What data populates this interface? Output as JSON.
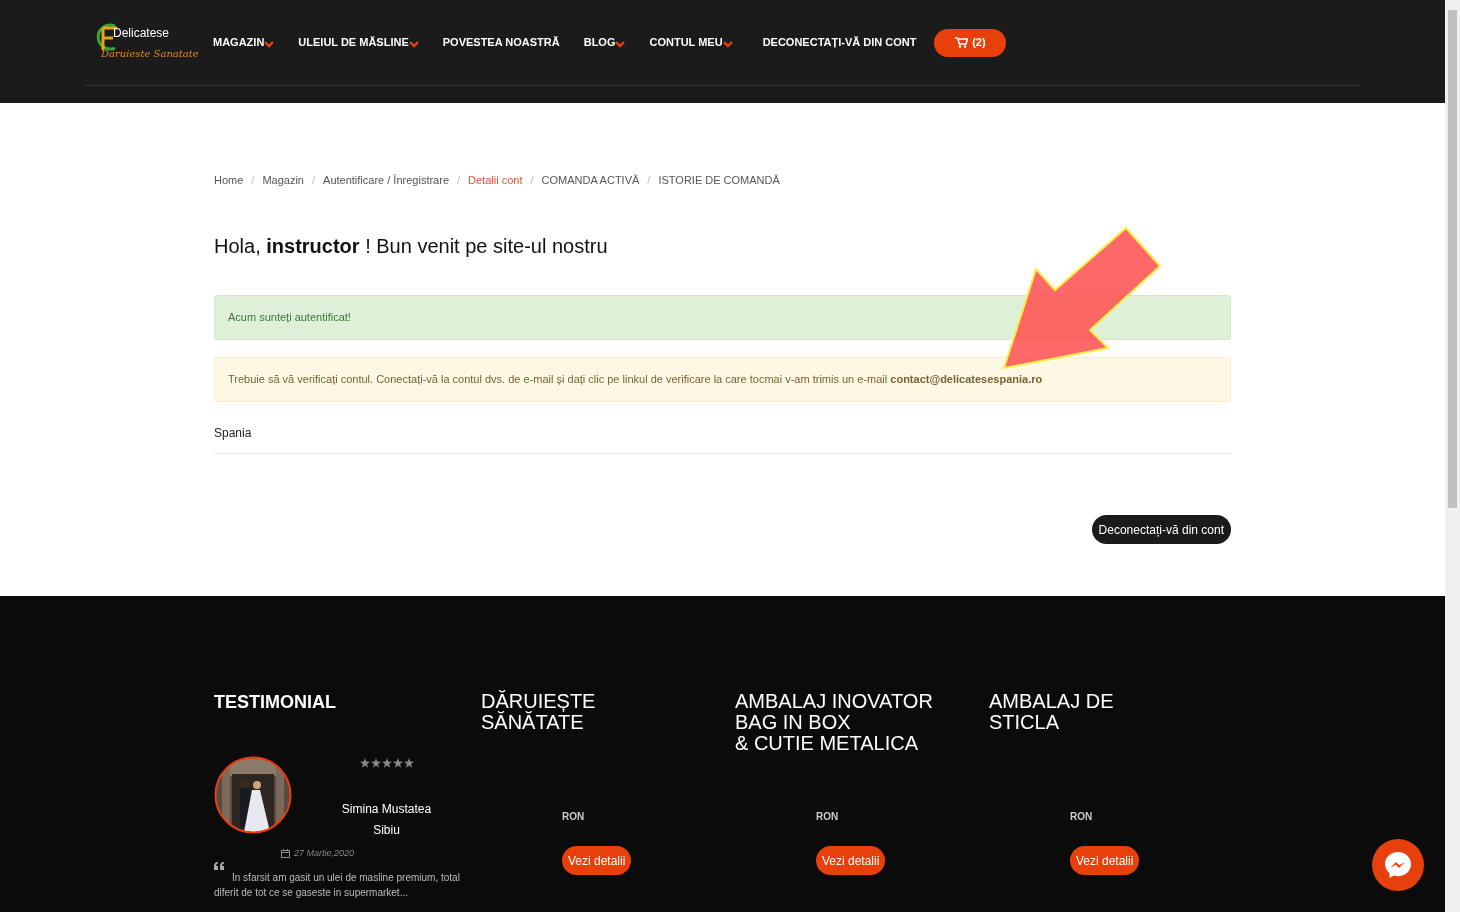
{
  "header": {
    "logo": {
      "name": "Delicatese",
      "tagline": "Daruieste Sanatate"
    },
    "nav": [
      {
        "label": "MAGAZIN",
        "dropdown": true
      },
      {
        "label": "ULEIUL DE MĂSLINE",
        "dropdown": true
      },
      {
        "label": "POVESTEA NOASTRĂ",
        "dropdown": false
      },
      {
        "label": "BLOG",
        "dropdown": true
      },
      {
        "label": "CONTUL MEU",
        "dropdown": true
      },
      {
        "label": "DECONECTAȚI-VĂ DIN CONT",
        "dropdown": false
      }
    ],
    "cart": "(2)"
  },
  "breadcrumb_separator": "/",
  "breadcrumb": [
    {
      "label": "Home",
      "selected": false
    },
    {
      "label": "Magazin",
      "selected": false
    },
    {
      "label": "Autentificare / Înregistrare",
      "selected": false
    },
    {
      "label": "Detalii cont",
      "selected": true
    },
    {
      "label": "COMANDA ACTIVĂ",
      "selected": false
    },
    {
      "label": "ISTORIE DE COMANDĂ",
      "selected": false
    }
  ],
  "greeting": "Hola, **instructor** ! Bun venit pe site-ul nostru",
  "alerts": [
    {
      "kind": "success",
      "text": "Acum sunteți autentificat!"
    },
    {
      "kind": "warning",
      "text": "Trebuie să vă verificați contul. Conectați-vă la contul dvs. de e-mail și dați clic pe linkul de verificare la care tocmai v-am trimis un e-mail **contact@delicatesespania.ro**"
    }
  ],
  "country": "Spania",
  "logout_button": "Deconectați-vă din cont",
  "footer": {
    "testimonial": {
      "heading": "TESTIMONIAL",
      "stars": 5,
      "name": "Simina Mustatea",
      "city": "Sibiu",
      "date": "27 Martie,2020",
      "quote": "In sfarsit am gasit un ulei de masline premium, total diferit de tot ce se gaseste in supermarket..."
    },
    "products": [
      {
        "title": [
          "DĂRUIEȘTE",
          "SĂNĂTATE"
        ],
        "currency": "RON",
        "button": "Vezi detalii"
      },
      {
        "title": [
          "AMBALAJ INOVATOR",
          "BAG IN BOX",
          "& CUTIE METALICA"
        ],
        "currency": "RON",
        "button": "Vezi detalii"
      },
      {
        "title": [
          "AMBALAJ DE",
          "STICLA"
        ],
        "currency": "RON",
        "button": "Vezi detalii"
      }
    ]
  }
}
